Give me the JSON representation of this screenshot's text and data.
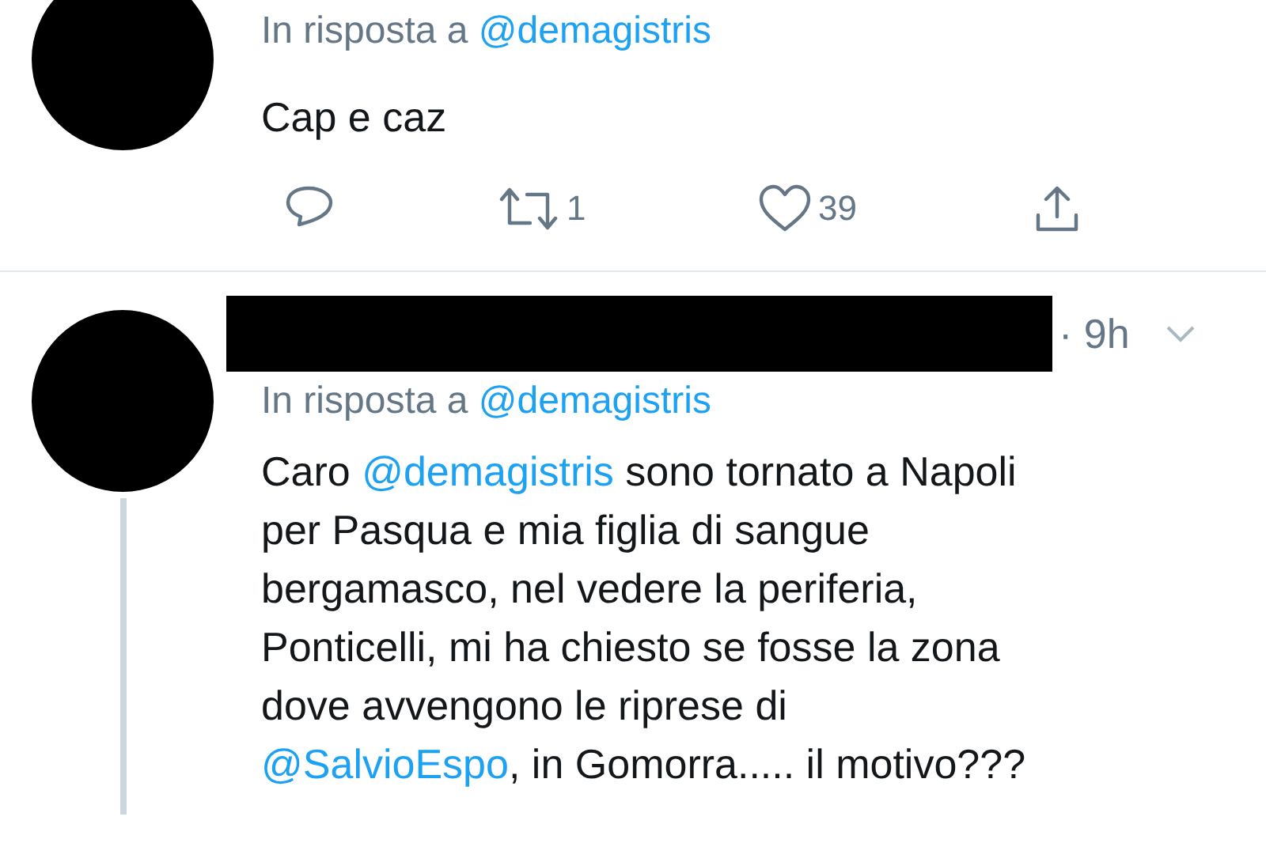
{
  "tweets": [
    {
      "reply_prefix": "In risposta a",
      "reply_to": "@demagistris",
      "redacted_header": false,
      "lines": [
        [
          {
            "kind": "text",
            "text": "Cap e caz"
          }
        ]
      ],
      "actions": {
        "retweets": "1",
        "likes": "39"
      },
      "thread_line": false
    },
    {
      "reply_prefix": "In risposta a",
      "reply_to": "@demagistris",
      "redacted_header": true,
      "time": "· 9h",
      "lines": [
        [
          {
            "kind": "text",
            "text": "Caro "
          },
          {
            "kind": "mention",
            "text": "@demagistris"
          },
          {
            "kind": "text",
            "text": " sono tornato a Napoli"
          }
        ],
        [
          {
            "kind": "text",
            "text": "per Pasqua e mia figlia di sangue"
          }
        ],
        [
          {
            "kind": "text",
            "text": "bergamasco, nel vedere la periferia,"
          }
        ],
        [
          {
            "kind": "text",
            "text": "Ponticelli, mi ha chiesto se fosse la zona"
          }
        ],
        [
          {
            "kind": "text",
            "text": "dove avvengono le riprese di"
          }
        ],
        [
          {
            "kind": "mention",
            "text": "@SalvioEspo"
          },
          {
            "kind": "text",
            "text": ", in Gomorra..... il motivo???"
          }
        ]
      ],
      "thread_line": true
    }
  ]
}
